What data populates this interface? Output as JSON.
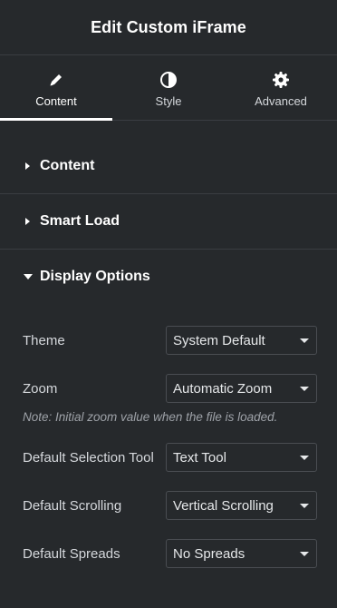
{
  "header": {
    "title": "Edit Custom iFrame"
  },
  "tabs": [
    {
      "label": "Content",
      "icon": "pencil-icon",
      "active": true
    },
    {
      "label": "Style",
      "icon": "half-circle-icon",
      "active": false
    },
    {
      "label": "Advanced",
      "icon": "gear-icon",
      "active": false
    }
  ],
  "sections": {
    "content": {
      "title": "Content",
      "expanded": false
    },
    "smart_load": {
      "title": "Smart Load",
      "expanded": false
    },
    "display_options": {
      "title": "Display Options",
      "expanded": true
    }
  },
  "display_options": {
    "theme": {
      "label": "Theme",
      "value": "System Default"
    },
    "zoom": {
      "label": "Zoom",
      "value": "Automatic Zoom",
      "note": "Note: Initial zoom value when the file is loaded."
    },
    "selection_tool": {
      "label": "Default Selection Tool",
      "value": "Text Tool"
    },
    "scrolling": {
      "label": "Default Scrolling",
      "value": "Vertical Scrolling"
    },
    "spreads": {
      "label": "Default Spreads",
      "value": "No Spreads"
    }
  },
  "colors": {
    "background": "#26292c",
    "border": "#3a3d42",
    "text": "#d5d8dc",
    "note": "#9ea2a8"
  }
}
